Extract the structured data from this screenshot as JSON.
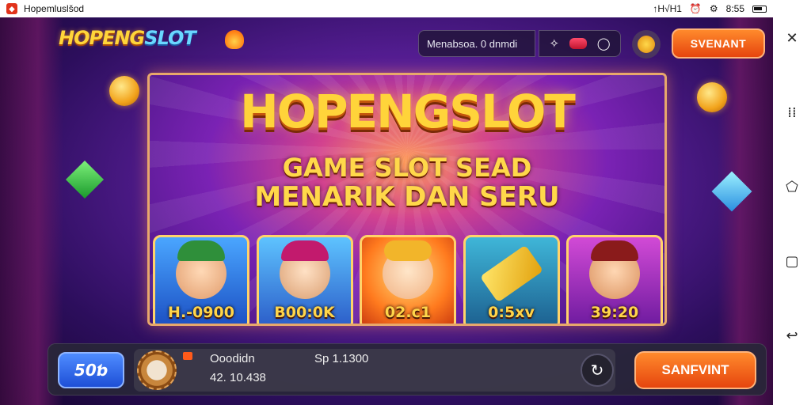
{
  "statusbar": {
    "app_title": "Hopemluslšod",
    "right_text": "↑H√H1",
    "time": "8:55",
    "icons": [
      "signal-icon",
      "alarm-icon",
      "battery-icon"
    ]
  },
  "header": {
    "logo_part1": "HOPENG",
    "logo_part2": "SLOT",
    "search_text": "Menabsoa. 0 dnmdi",
    "tools": [
      "pin-icon",
      "gem-icon",
      "location-icon"
    ],
    "cta_label": "SVENANT"
  },
  "banner": {
    "title": "HOPENGSLOT",
    "subtitle1": "GAME SLOT SEAD",
    "subtitle2": "MENARIK DAN SERU",
    "cards": [
      {
        "value": "H.-0900"
      },
      {
        "value": "B00:0K"
      },
      {
        "value": "02.c1"
      },
      {
        "value": "0:5хv"
      },
      {
        "value": "39:20"
      }
    ]
  },
  "bottom": {
    "left_button": "50ƅ",
    "name": "Ooodidn",
    "value1": "42. 10.438",
    "value2": "Sp 1.1300",
    "cta_label": "SANFVINT"
  },
  "colors": {
    "accent_orange": "#e6450e",
    "accent_gold": "#ffd43a",
    "bg_purple": "#5a1f9a",
    "blue_button": "#1e4fd6"
  }
}
